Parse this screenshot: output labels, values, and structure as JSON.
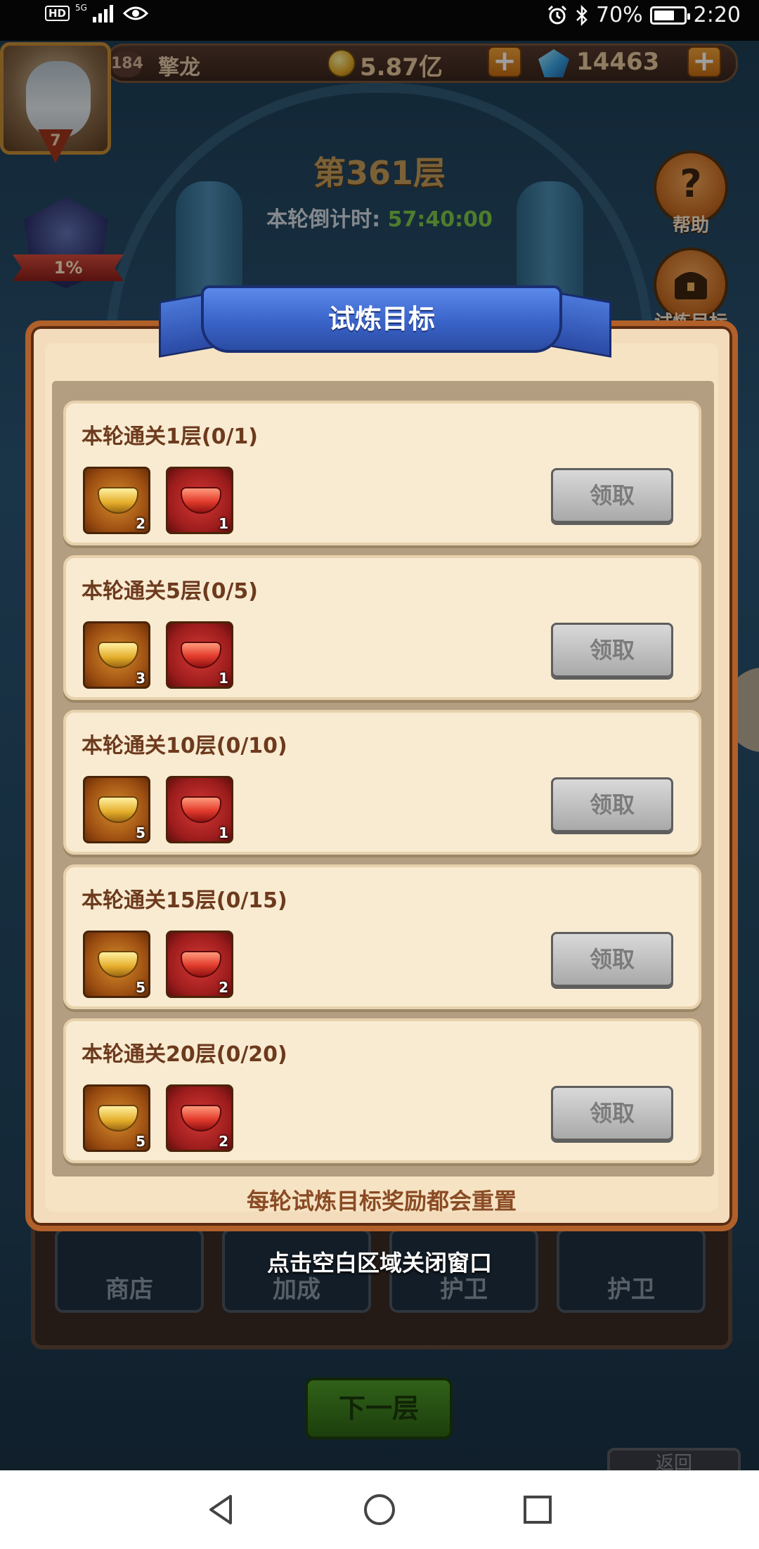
{
  "status_bar": {
    "network_badge": "HD",
    "network_type": "5G",
    "battery_percent": 70,
    "battery_text": "70%",
    "time": "2:20",
    "icons": [
      "hd-icon",
      "signal-icon",
      "eye-icon",
      "alarm-icon",
      "bluetooth-icon",
      "battery-icon"
    ]
  },
  "hud": {
    "player_level": "184",
    "player_name": "擎龙",
    "gold": "5.87亿",
    "diamonds": "14463",
    "avatar_level": "7",
    "rank_percent": "1%"
  },
  "tower": {
    "floor_title": "第361层",
    "countdown_label": "本轮倒计时:",
    "countdown_value": "57:40:00"
  },
  "side_buttons": [
    {
      "label": "帮助",
      "icon": "question-icon"
    },
    {
      "label": "试炼目标",
      "icon": "treasure-chest-icon"
    }
  ],
  "dialog": {
    "title": "试炼目标",
    "footer": "每轮试炼目标奖励都会重置",
    "claim_label": "领取",
    "rows": [
      {
        "title": "本轮通关1层(0/1)",
        "rewards": [
          {
            "icon": "gold-ingot-icon",
            "qty": "2"
          },
          {
            "icon": "red-ingot-icon",
            "qty": "1"
          }
        ]
      },
      {
        "title": "本轮通关5层(0/5)",
        "rewards": [
          {
            "icon": "gold-ingot-icon",
            "qty": "3"
          },
          {
            "icon": "red-ingot-icon",
            "qty": "1"
          }
        ]
      },
      {
        "title": "本轮通关10层(0/10)",
        "rewards": [
          {
            "icon": "gold-ingot-icon",
            "qty": "5"
          },
          {
            "icon": "red-ingot-icon",
            "qty": "1"
          }
        ]
      },
      {
        "title": "本轮通关15层(0/15)",
        "rewards": [
          {
            "icon": "gold-ingot-icon",
            "qty": "5"
          },
          {
            "icon": "red-ingot-icon",
            "qty": "2"
          }
        ]
      },
      {
        "title": "本轮通关20层(0/20)",
        "rewards": [
          {
            "icon": "gold-ingot-icon",
            "qty": "5"
          },
          {
            "icon": "red-ingot-icon",
            "qty": "2"
          }
        ]
      }
    ]
  },
  "close_hint": "点击空白区域关闭窗口",
  "tray": {
    "buttons": [
      "商店",
      "加成",
      "护卫",
      "护卫"
    ]
  },
  "next_button": "下一层",
  "back_button": "返回",
  "colors": {
    "dialog_bg": "#f2dcbc",
    "dialog_border": "#b1602a",
    "ribbon_blue": "#3a63c8",
    "countdown_green": "#7ec84a",
    "floor_gold": "#c79d59",
    "claim_disabled": "#a9a9a9"
  },
  "nav_bar": {
    "icons": [
      "back-triangle-icon",
      "home-circle-icon",
      "recents-square-icon"
    ]
  }
}
